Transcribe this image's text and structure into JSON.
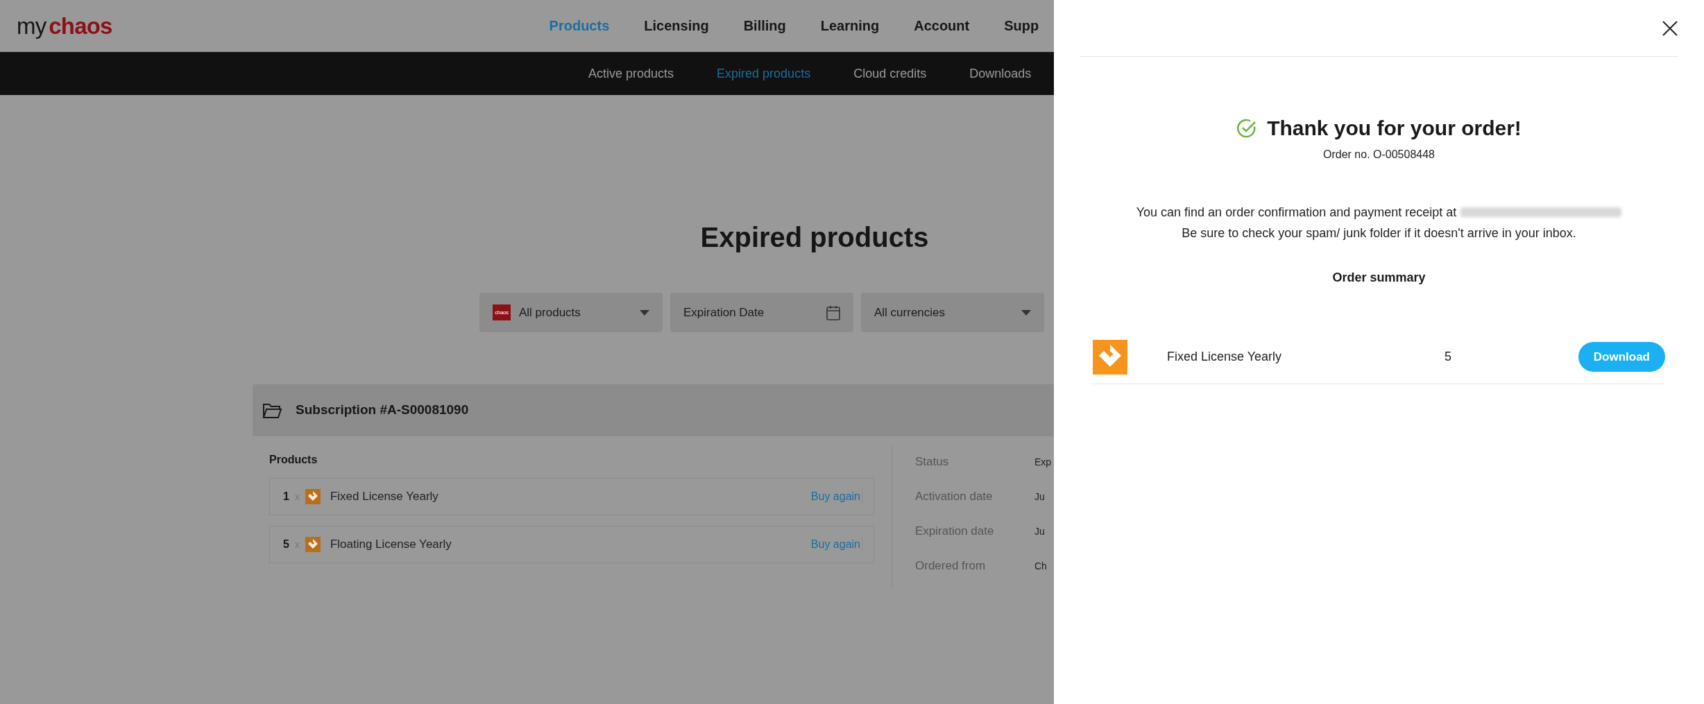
{
  "header": {
    "logo": {
      "prefix": "my",
      "brand": "chaos"
    },
    "nav": [
      {
        "label": "Products",
        "selected": true
      },
      {
        "label": "Licensing",
        "selected": false
      },
      {
        "label": "Billing",
        "selected": false
      },
      {
        "label": "Learning",
        "selected": false
      },
      {
        "label": "Account",
        "selected": false
      },
      {
        "label": "Supp",
        "selected": false
      }
    ]
  },
  "subnav": [
    {
      "label": "Active products",
      "selected": false
    },
    {
      "label": "Expired products",
      "selected": true
    },
    {
      "label": "Cloud credits",
      "selected": false
    },
    {
      "label": "Downloads",
      "selected": false
    }
  ],
  "page": {
    "title": "Expired products",
    "filters": [
      {
        "kind": "dropdown",
        "label": "All products",
        "badge": "chaos"
      },
      {
        "kind": "date",
        "label": "Expiration Date"
      },
      {
        "kind": "dropdown",
        "label": "All currencies"
      }
    ],
    "subscription": {
      "title": "Subscription #A-S00081090",
      "products_heading": "Products",
      "products": [
        {
          "quantity": "1",
          "times": "x",
          "name": "Fixed License Yearly",
          "action": "Buy again"
        },
        {
          "quantity": "5",
          "times": "x",
          "name": "Floating License Yearly",
          "action": "Buy again"
        }
      ],
      "details": [
        {
          "label": "Status",
          "value": "Exp"
        },
        {
          "label": "Activation date",
          "value": "Ju"
        },
        {
          "label": "Expiration date",
          "value": "Ju"
        },
        {
          "label": "Ordered from",
          "value": "Ch"
        }
      ]
    }
  },
  "order_panel": {
    "title": "Thank you for your order!",
    "order_number": "Order no. O-00508448",
    "message_lines": [
      "You can find an order confirmation and payment receipt at",
      "Be sure to check your spam/ junk folder if it doesn't arrive in your inbox."
    ],
    "summary_heading": "Order summary",
    "items": [
      {
        "name": "Fixed License Yearly",
        "quantity": "5",
        "action": "Download"
      }
    ]
  }
}
